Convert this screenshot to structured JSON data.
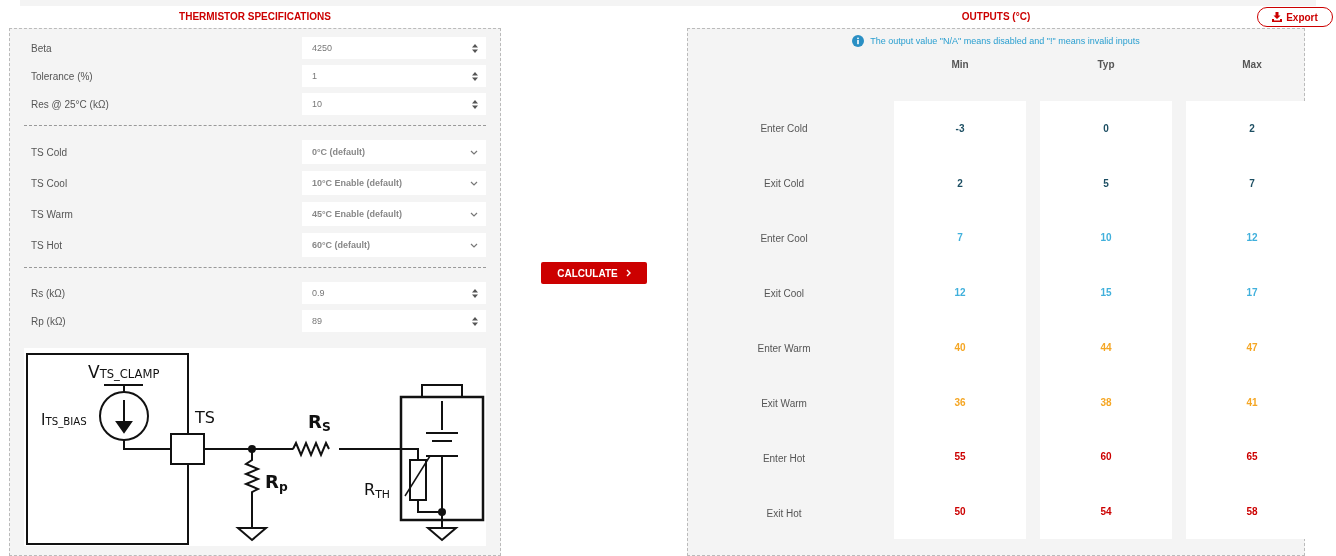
{
  "specs": {
    "title": "THERMISTOR SPECIFICATIONS",
    "groups": [
      {
        "fields": [
          {
            "kind": "number",
            "label": "Beta",
            "value": "4250"
          },
          {
            "kind": "number",
            "label": "Tolerance (%)",
            "value": "1"
          },
          {
            "kind": "number",
            "label": "Res @ 25°C (kΩ)",
            "value": "10"
          }
        ]
      },
      {
        "fields": [
          {
            "kind": "select",
            "label": "TS Cold",
            "value": "0°C (default)"
          },
          {
            "kind": "select",
            "label": "TS Cool",
            "value": "10°C Enable (default)"
          },
          {
            "kind": "select",
            "label": "TS Warm",
            "value": "45°C Enable (default)"
          },
          {
            "kind": "select",
            "label": "TS Hot",
            "value": "60°C (default)"
          }
        ]
      },
      {
        "fields": [
          {
            "kind": "number",
            "label": "Rs (kΩ)",
            "value": "0.9"
          },
          {
            "kind": "number",
            "label": "Rp (kΩ)",
            "value": "89"
          }
        ]
      }
    ],
    "diagram": {
      "labels": [
        {
          "base": "V",
          "sub": "TS_CLAMP"
        },
        {
          "base": "I",
          "sub": "TS_BIAS"
        },
        {
          "base": "TS"
        },
        {
          "base": "R",
          "sub": "S"
        },
        {
          "base": "R",
          "sub": "p"
        },
        {
          "base": "R",
          "sub": "TH"
        }
      ]
    }
  },
  "calculate": {
    "label": "CALCULATE"
  },
  "outputs": {
    "title": "OUTPUTS (°C)",
    "export": "Export",
    "note": "The output value \"N/A\" means disabled and \"!\" means invalid inputs",
    "columns": [
      "Min",
      "Typ",
      "Max"
    ],
    "rows": [
      {
        "label": "Enter Cold",
        "color": "#1d4f63",
        "values": [
          "-3",
          "0",
          "2"
        ]
      },
      {
        "label": "Exit Cold",
        "color": "#1d4f63",
        "values": [
          "2",
          "5",
          "7"
        ]
      },
      {
        "label": "Enter Cool",
        "color": "#40b0dc",
        "values": [
          "7",
          "10",
          "12"
        ]
      },
      {
        "label": "Exit Cool",
        "color": "#40b0dc",
        "values": [
          "12",
          "15",
          "17"
        ]
      },
      {
        "label": "Enter Warm",
        "color": "#f5a623",
        "values": [
          "40",
          "44",
          "47"
        ]
      },
      {
        "label": "Exit Warm",
        "color": "#f5a623",
        "values": [
          "36",
          "38",
          "41"
        ]
      },
      {
        "label": "Enter Hot",
        "color": "#cc0000",
        "values": [
          "55",
          "60",
          "65"
        ]
      },
      {
        "label": "Exit Hot",
        "color": "#cc0000",
        "values": [
          "50",
          "54",
          "58"
        ]
      }
    ]
  }
}
